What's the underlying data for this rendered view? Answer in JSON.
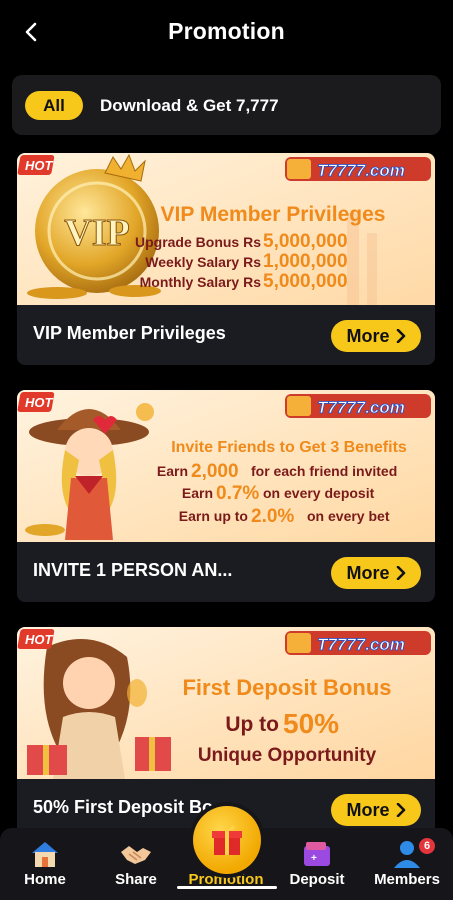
{
  "header": {
    "title": "Promotion"
  },
  "filters": {
    "all_label": "All",
    "tab_label": "Download & Get 7,777"
  },
  "brand": {
    "logo_text": "T7777.com",
    "hot_label": "HOT"
  },
  "cards": [
    {
      "banner": {
        "headline": "VIP Member Privileges",
        "emblem": "VIP",
        "lines": [
          {
            "label": "Upgrade Bonus Rs",
            "value": "5,000,000"
          },
          {
            "label": "Weekly Salary Rs",
            "value": "1,000,000"
          },
          {
            "label": "Monthly Salary Rs",
            "value": "5,000,000"
          }
        ]
      },
      "title": "VIP Member Privileges",
      "button": "More"
    },
    {
      "banner": {
        "headline": "Invite Friends to Get 3 Benefits",
        "lines": [
          {
            "pre": "Earn",
            "value": "2,000",
            "post": "for each friend invited"
          },
          {
            "pre": "Earn",
            "value": "0.7%",
            "post": "on every deposit"
          },
          {
            "pre": "Earn up to",
            "value": "2.0%",
            "post": "on every bet"
          }
        ]
      },
      "title": "INVITE 1 PERSON AN...",
      "button": "More"
    },
    {
      "banner": {
        "headline": "First Deposit Bonus",
        "line1_pre": "Up to",
        "line1_value": "50%",
        "line2": "Unique Opportunity"
      },
      "title": "50% First Deposit Bo",
      "button": "More"
    }
  ],
  "nav": {
    "items": [
      {
        "label": "Home",
        "icon": "home-icon"
      },
      {
        "label": "Share",
        "icon": "handshake-icon"
      },
      {
        "label": "Promotion",
        "icon": "gift-icon"
      },
      {
        "label": "Deposit",
        "icon": "wallet-icon"
      },
      {
        "label": "Members",
        "icon": "members-icon"
      }
    ],
    "members_badge": "6"
  },
  "colors": {
    "accent": "#f7c71a",
    "card_bg": "#1b1c22",
    "banner_text": "#f08a1a",
    "badge": "#e5353c"
  }
}
